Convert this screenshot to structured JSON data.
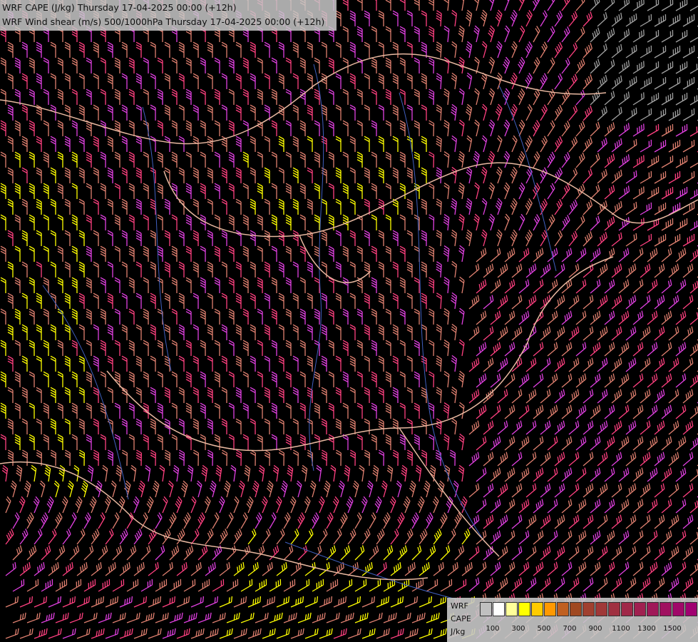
{
  "header": {
    "line1": "WRF CAPE (J/kg) Thursday 17-04-2025 00:00 (+12h)",
    "line2": "WRF Wind shear (m/s) 500/1000hPa Thursday 17-04-2025 00:00 (+12h)"
  },
  "legend": {
    "label_wrf": "WRF",
    "label_cape": "CAPE",
    "label_unit": "J/kg",
    "colors": [
      "#c0c0c0",
      "#ffffff",
      "#ffff99",
      "#ffff00",
      "#ffcc00",
      "#ff9900",
      "#c06020",
      "#a04820",
      "#a04030",
      "#a03838",
      "#a03040",
      "#a02848",
      "#a02050",
      "#a01858",
      "#a01060",
      "#a00868",
      "#a00070"
    ],
    "ticks": [
      "100",
      "300",
      "500",
      "700",
      "900",
      "1100",
      "1300",
      "1500"
    ]
  },
  "map": {
    "barb_colors": {
      "low": "#e08070",
      "mid": "#ff4080",
      "high": "#e040e0",
      "yellow": "#ffff00",
      "grey": "#a0a0a0"
    },
    "border_color": "#e8b8a0",
    "river_color": "#4060c0"
  }
}
